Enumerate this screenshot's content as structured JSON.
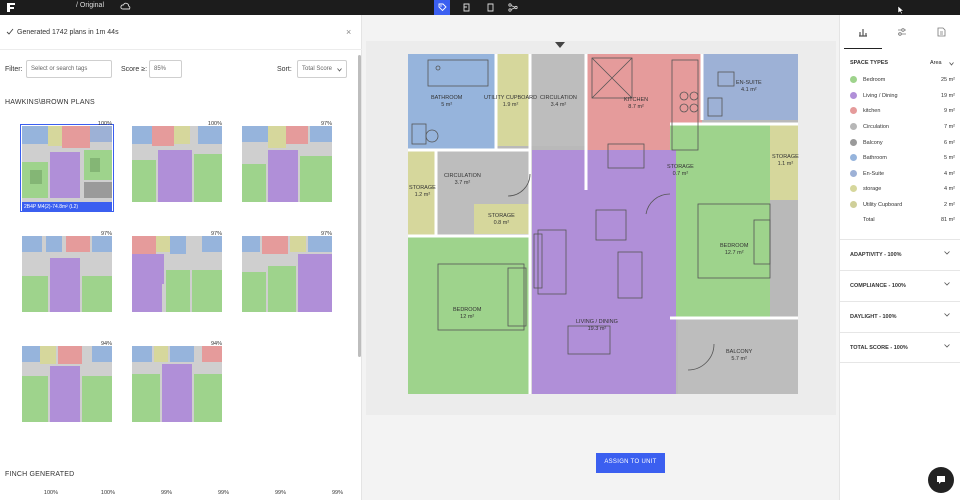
{
  "topbar": {
    "breadcrumb": "/ Original",
    "tools": [
      "tag-icon",
      "floor-icon",
      "unit-icon",
      "share-icon"
    ]
  },
  "left": {
    "generated_text": "Generated 1742 plans in 1m 44s",
    "filter_label": "Filter:",
    "filter_placeholder": "Select or search tags",
    "score_label": "Score ≥:",
    "score_value": "85%",
    "sort_label": "Sort:",
    "sort_value": "Total Score",
    "section1_title": "HAWKINS\\BROWN PLANS",
    "section2_title": "FINCH GENERATED",
    "thumbs": [
      {
        "pct": "100%",
        "name": "2B4P M4(2)-74.8m² (L2)"
      },
      {
        "pct": "100%"
      },
      {
        "pct": "97%"
      },
      {
        "pct": "97%"
      },
      {
        "pct": "97%"
      },
      {
        "pct": "97%"
      },
      {
        "pct": "94%"
      },
      {
        "pct": "94%"
      }
    ],
    "finch_pcts": [
      "100%",
      "100%",
      "99%",
      "99%",
      "99%",
      "99%"
    ]
  },
  "plan": {
    "rooms": [
      {
        "name": "BATHROOM",
        "area": "5 m²"
      },
      {
        "name": "UTILITY CUPBOARD",
        "area": "1.9 m²"
      },
      {
        "name": "CIRCULATION",
        "area": "3.4 m²"
      },
      {
        "name": "KITCHEN",
        "area": "8.7 m²"
      },
      {
        "name": "EN-SUITE",
        "area": "4.1 m²"
      },
      {
        "name": "STORAGE",
        "area": "1.2 m²"
      },
      {
        "name": "CIRCULATION",
        "area": "3.7 m²"
      },
      {
        "name": "STORAGE",
        "area": "0.8 m²"
      },
      {
        "name": "STORAGE",
        "area": "0.7 m²"
      },
      {
        "name": "STORAGE",
        "area": "1.1 m²"
      },
      {
        "name": "BEDROOM",
        "area": "12.7 m²"
      },
      {
        "name": "BEDROOM",
        "area": "12 m²"
      },
      {
        "name": "LIVING / DINING",
        "area": "19.3 m²"
      },
      {
        "name": "BALCONY",
        "area": "5.7 m²"
      }
    ],
    "assign_label": "ASSIGN TO UNIT"
  },
  "right": {
    "space_types_title": "SPACE TYPES",
    "metric_select": "Area",
    "legend": [
      {
        "name": "Bedroom",
        "value": "25 m²",
        "color": "#9ed38c"
      },
      {
        "name": "Living / Dining",
        "value": "19 m²",
        "color": "#b08fd8"
      },
      {
        "name": "kitchen",
        "value": "9 m²",
        "color": "#e59b9b"
      },
      {
        "name": "Circulation",
        "value": "7 m²",
        "color": "#b7b7b7"
      },
      {
        "name": "Balcony",
        "value": "6 m²",
        "color": "#9a9a9a"
      },
      {
        "name": "Bathroom",
        "value": "5 m²",
        "color": "#96b4dc"
      },
      {
        "name": "En-Suite",
        "value": "4 m²",
        "color": "#9db1d6"
      },
      {
        "name": "storage",
        "value": "4 m²",
        "color": "#d6d79c"
      },
      {
        "name": "Utility Cupboard",
        "value": "2 m²",
        "color": "#cfcf99"
      }
    ],
    "total_label": "Total",
    "total_value": "81 m²",
    "accordions": [
      "ADAPTIVITY - 100%",
      "COMPLIANCE - 100%",
      "DAYLIGHT - 100%",
      "TOTAL SCORE - 100%"
    ]
  }
}
